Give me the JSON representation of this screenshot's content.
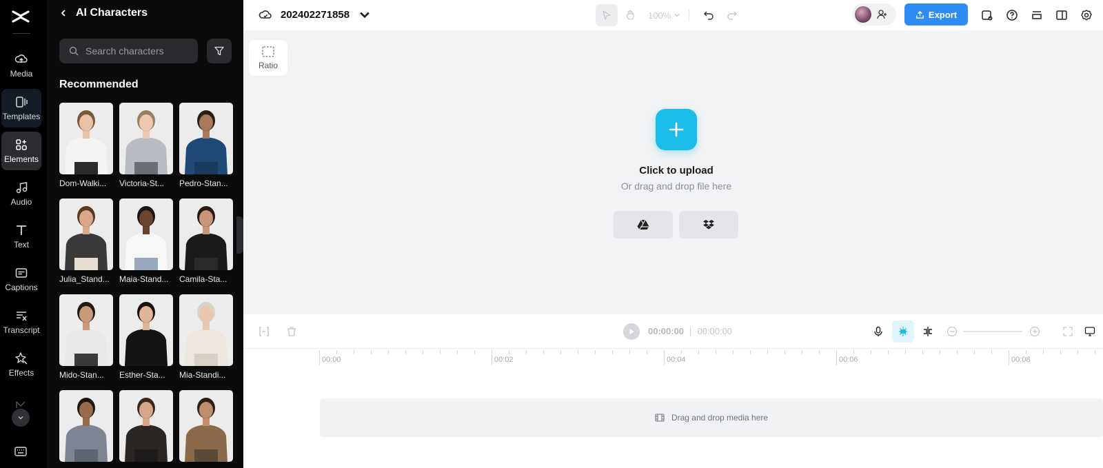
{
  "rail": {
    "items": [
      {
        "label": "Media",
        "icon": "media-cloud-icon"
      },
      {
        "label": "Templates",
        "icon": "templates-icon"
      },
      {
        "label": "Elements",
        "icon": "elements-icon"
      },
      {
        "label": "Audio",
        "icon": "music-note-icon"
      },
      {
        "label": "Text",
        "icon": "text-t-icon"
      },
      {
        "label": "Captions",
        "icon": "captions-icon"
      },
      {
        "label": "Transcript",
        "icon": "transcript-icon"
      },
      {
        "label": "Effects",
        "icon": "effects-sparkle-icon"
      }
    ],
    "active": "Elements"
  },
  "panel": {
    "title": "AI Characters",
    "search_placeholder": "Search characters",
    "section": "Recommended",
    "characters": [
      {
        "name": "Dom-Walki...",
        "top": "#f4f4f4",
        "bottom": "#2a2a2a",
        "hair": "#7a5a3a",
        "skin": "#e8c3a8"
      },
      {
        "name": "Victoria-St...",
        "top": "#b9bcc2",
        "bottom": "#6a6e76",
        "hair": "#9a8060",
        "skin": "#ecc8b0"
      },
      {
        "name": "Pedro-Stan...",
        "top": "#1f4a78",
        "bottom": "#1a3a5e",
        "hair": "#2a1d14",
        "skin": "#a9785a"
      },
      {
        "name": "Julia_Stand...",
        "top": "#3a3a3a",
        "bottom": "#e6dcd0",
        "hair": "#5a3a22",
        "skin": "#d9a888"
      },
      {
        "name": "Maia-Stand...",
        "top": "#f7f7f7",
        "bottom": "#9aa8bd",
        "hair": "#1b1410",
        "skin": "#6b4530"
      },
      {
        "name": "Camila-Sta...",
        "top": "#1a1a1a",
        "bottom": "#2a2a2a",
        "hair": "#2a1a10",
        "skin": "#c99678"
      },
      {
        "name": "Mido-Stan...",
        "top": "#e8e8e8",
        "bottom": "#3a3a3a",
        "hair": "#1e1a16",
        "skin": "#c99a7a"
      },
      {
        "name": "Esther-Sta...",
        "top": "#141414",
        "bottom": "#141414",
        "hair": "#161210",
        "skin": "#e0b494"
      },
      {
        "name": "Mia-Standi...",
        "top": "#ece6dc",
        "bottom": "#d9d0c4",
        "hair": "#d8d2c8",
        "skin": "#e9c6ae"
      },
      {
        "name": "",
        "top": "#7e8592",
        "bottom": "#5e6470",
        "hair": "#1e1410",
        "skin": "#9a6a4c"
      },
      {
        "name": "",
        "top": "#2a2623",
        "bottom": "#1e1c1a",
        "hair": "#3a2a1e",
        "skin": "#d6a888"
      },
      {
        "name": "",
        "top": "#8a6a48",
        "bottom": "#5a4a38",
        "hair": "#2a1e16",
        "skin": "#c08e6e"
      }
    ]
  },
  "topbar": {
    "project_name": "202402271858",
    "zoom": "100%",
    "export_label": "Export"
  },
  "canvas": {
    "ratio_label": "Ratio",
    "upload_title": "Click to upload",
    "upload_sub": "Or drag and drop file here"
  },
  "timeline": {
    "current_time": "00:00:00",
    "total_time": "00:00:00",
    "ruler": [
      "00:00",
      "00:02",
      "00:04",
      "00:06",
      "00:08"
    ],
    "dropzone_text": "Drag and drop media here"
  }
}
